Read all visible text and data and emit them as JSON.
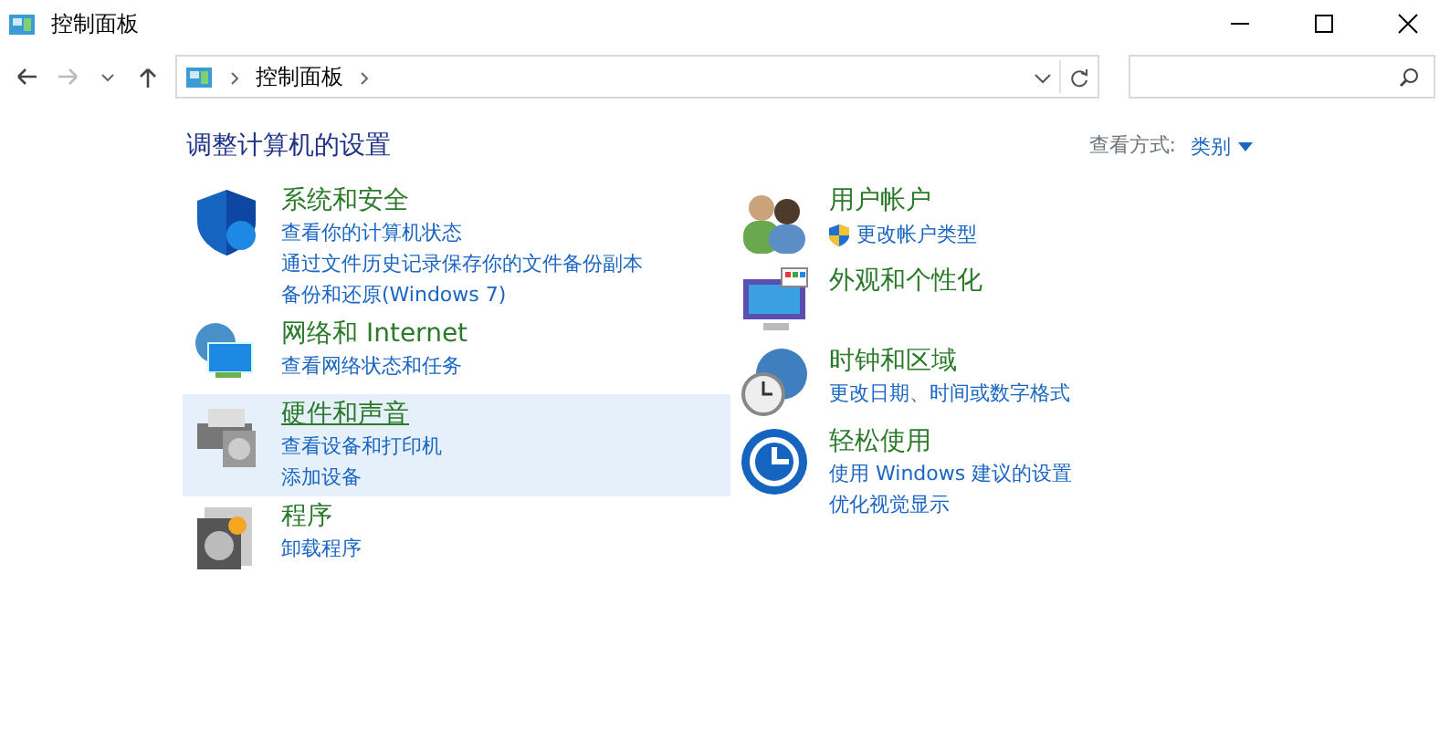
{
  "window": {
    "title": "控制面板"
  },
  "address": {
    "crumbs": [
      "控制面板"
    ]
  },
  "heading": "调整计算机的设置",
  "view_by": {
    "label": "查看方式:",
    "value": "类别"
  },
  "columns": [
    [
      {
        "title": "系统和安全",
        "selected": false,
        "links": [
          {
            "text": "查看你的计算机状态",
            "shield": false
          },
          {
            "text": "通过文件历史记录保存你的文件备份副本",
            "shield": false
          },
          {
            "text": "备份和还原(Windows 7)",
            "shield": false
          }
        ]
      },
      {
        "title": "网络和 Internet",
        "selected": false,
        "links": [
          {
            "text": "查看网络状态和任务",
            "shield": false
          }
        ]
      },
      {
        "title": "硬件和声音",
        "selected": true,
        "links": [
          {
            "text": "查看设备和打印机",
            "shield": false
          },
          {
            "text": "添加设备",
            "shield": false
          }
        ]
      },
      {
        "title": "程序",
        "selected": false,
        "links": [
          {
            "text": "卸载程序",
            "shield": false
          }
        ]
      }
    ],
    [
      {
        "title": "用户帐户",
        "selected": false,
        "links": [
          {
            "text": "更改帐户类型",
            "shield": true
          }
        ]
      },
      {
        "title": "外观和个性化",
        "selected": false
      },
      {
        "title": "时钟和区域",
        "selected": false,
        "links": [
          {
            "text": "更改日期、时间或数字格式",
            "shield": false
          }
        ]
      },
      {
        "title": "轻松使用",
        "selected": false,
        "links": [
          {
            "text": "使用 Windows 建议的设置",
            "shield": false
          },
          {
            "text": "优化视觉显示",
            "shield": false
          }
        ]
      }
    ]
  ]
}
